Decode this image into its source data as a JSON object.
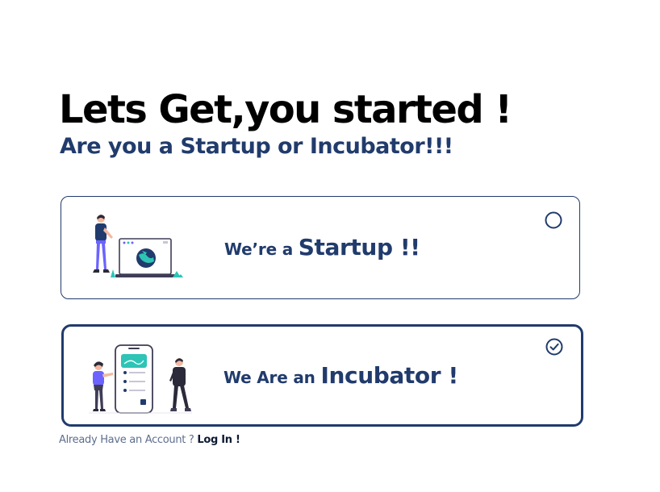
{
  "header": {
    "title": "Lets Get,you started !",
    "subtitle": "Are you a Startup or Incubator!!!"
  },
  "options": [
    {
      "id": "startup",
      "label_prefix": "We’re a ",
      "label_main": "Startup !!",
      "selected": false
    },
    {
      "id": "incubator",
      "label_prefix": "We Are an ",
      "label_main": "Incubator !",
      "selected": true
    }
  ],
  "footer": {
    "prompt": "Already Have an Account ?",
    "login_link": "Log In !"
  },
  "colors": {
    "primary": "#213b6c",
    "accent": "#2ec4b6",
    "illustration_purple": "#6c63ff",
    "skin": "#f3b8a0"
  }
}
